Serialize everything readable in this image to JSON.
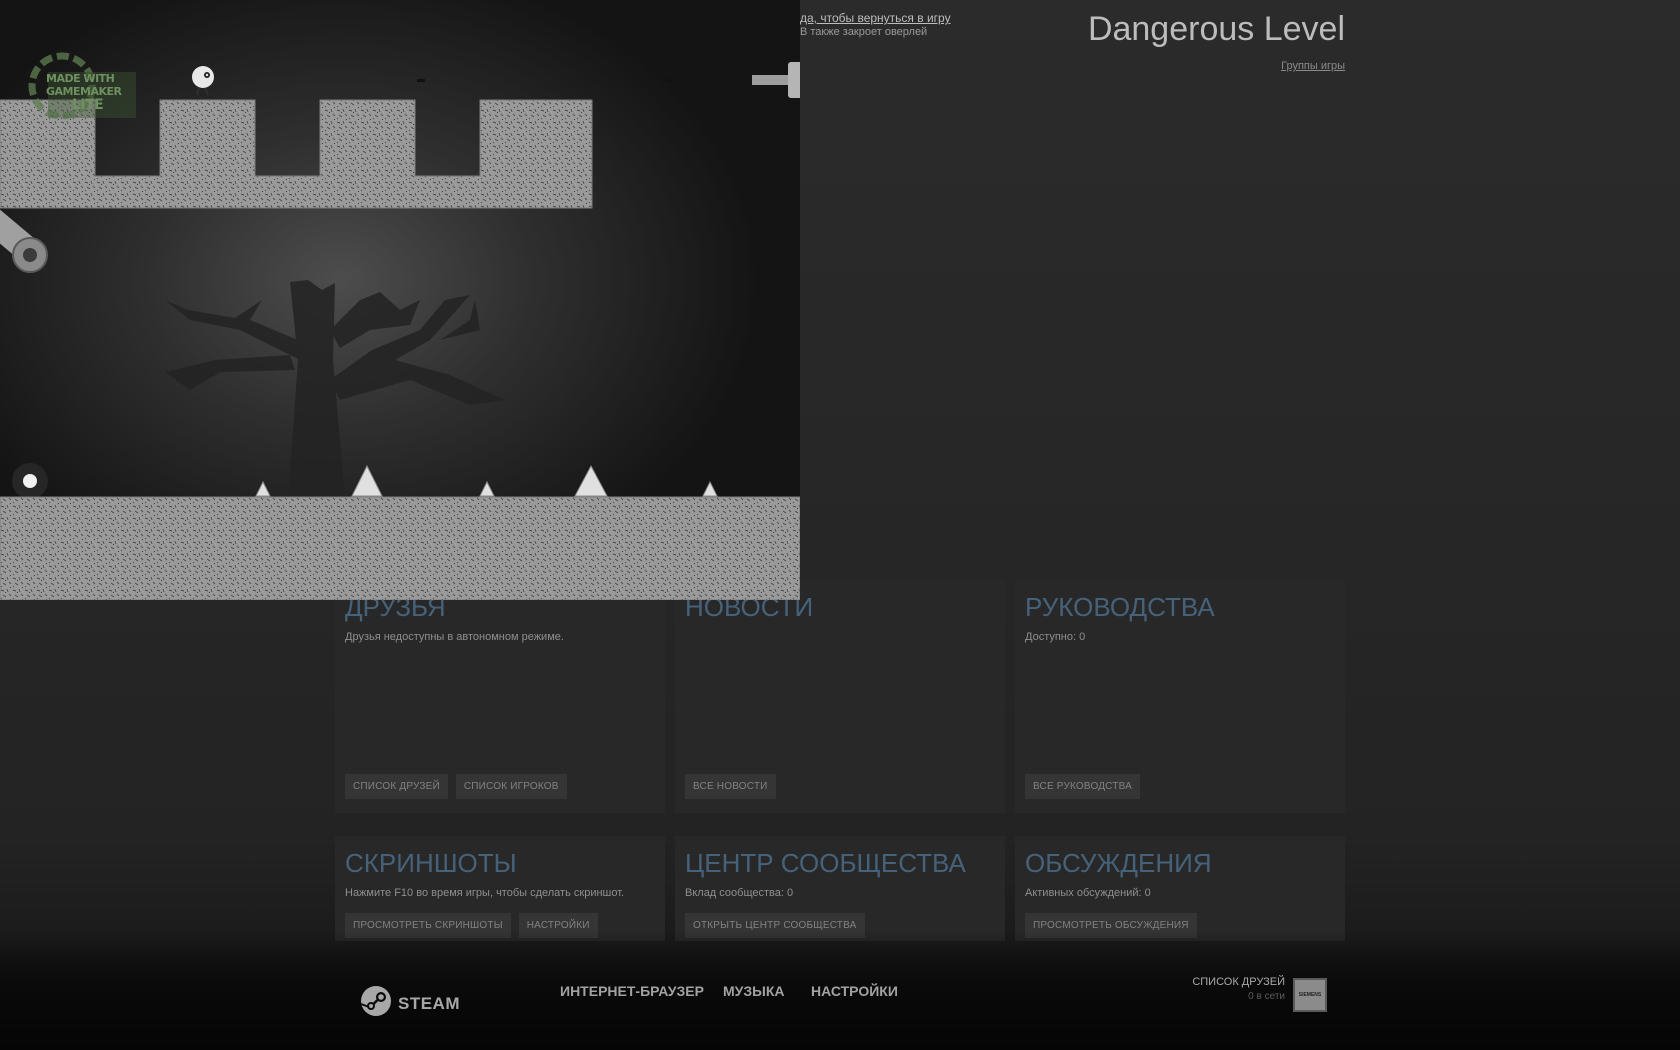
{
  "overlay": {
    "return_hint": "да, чтобы вернуться в игру",
    "close_hint": "В  также закроет оверлей",
    "game_title": "Dangerous Level",
    "groups_link": "Группы игры"
  },
  "panels": {
    "friends": {
      "title": "ДРУЗЬЯ",
      "subtitle": "Друзья недоступны в автономном режиме.",
      "buttons": [
        "СПИСОК ДРУЗЕЙ",
        "СПИСОК ИГРОКОВ"
      ]
    },
    "news": {
      "title": "НОВОСТИ",
      "buttons": [
        "ВСЕ НОВОСТИ"
      ]
    },
    "guides": {
      "title": "РУКОВОДСТВА",
      "subtitle": "Доступно: 0",
      "buttons": [
        "ВСЕ РУКОВОДСТВА"
      ]
    },
    "screenshots": {
      "title": "СКРИНШОТЫ",
      "subtitle": "Нажмите F10 во время игры, чтобы сделать скриншот.",
      "buttons": [
        "ПРОСМОТРЕТЬ СКРИНШОТЫ",
        "НАСТРОЙКИ"
      ]
    },
    "community": {
      "title": "ЦЕНТР СООБЩЕСТВА",
      "subtitle": "Вклад сообщества: 0",
      "buttons": [
        "ОТКРЫТЬ ЦЕНТР СООБЩЕСТВА"
      ]
    },
    "discussions": {
      "title": "ОБСУЖДЕНИЯ",
      "subtitle": "Активных обсуждений: 0",
      "buttons": [
        "ПРОСМОТРЕТЬ ОБСУЖДЕНИЯ"
      ]
    }
  },
  "footer": {
    "steam_label": "STEAM",
    "nav": [
      "ИНТЕРНЕТ-БРАУЗЕР",
      "МУЗЫКА",
      "НАСТРОЙКИ"
    ],
    "friends_list_label": "СПИСОК ДРУЗЕЙ",
    "online_count": "0 в сети",
    "avatar_text": "SIEMENS"
  },
  "game": {
    "badge_lines": [
      "MADE WITH",
      "GAMEMAKER",
      "LITE"
    ]
  }
}
